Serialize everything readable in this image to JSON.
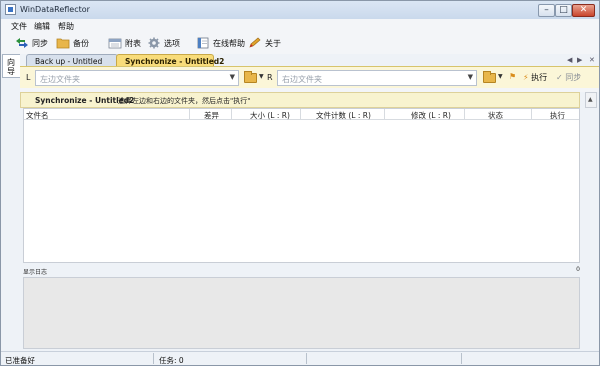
{
  "window": {
    "title": "WinDataReflector"
  },
  "menu": [
    "文件",
    "编辑",
    "帮助"
  ],
  "toolbar": {
    "sync": "同步",
    "backup": "备份",
    "attach": "附表",
    "options": "选项",
    "help": "在线帮助",
    "about": "关于"
  },
  "side_tab": "向导",
  "tabs": [
    "Back up - Untitled",
    "Synchronize - Untitled2"
  ],
  "path": {
    "left_label": "L",
    "left_placeholder": "左边文件夹",
    "right_label": "R",
    "right_placeholder": "右边文件夹",
    "execute": "执行",
    "sync": "同步"
  },
  "banner": {
    "title": "Synchronize - Untitled2",
    "hint": "选择左边和右边的文件夹，然后点击\"执行\""
  },
  "columns": [
    "文件名",
    "差异",
    "大小 (L : R)",
    "文件计数 (L : R)",
    "修改 (L : R)",
    "状态",
    "执行"
  ],
  "log": {
    "label": "显示日志",
    "toggle": "0"
  },
  "status": {
    "ready": "已准备好",
    "tasks": "任务: 0"
  }
}
